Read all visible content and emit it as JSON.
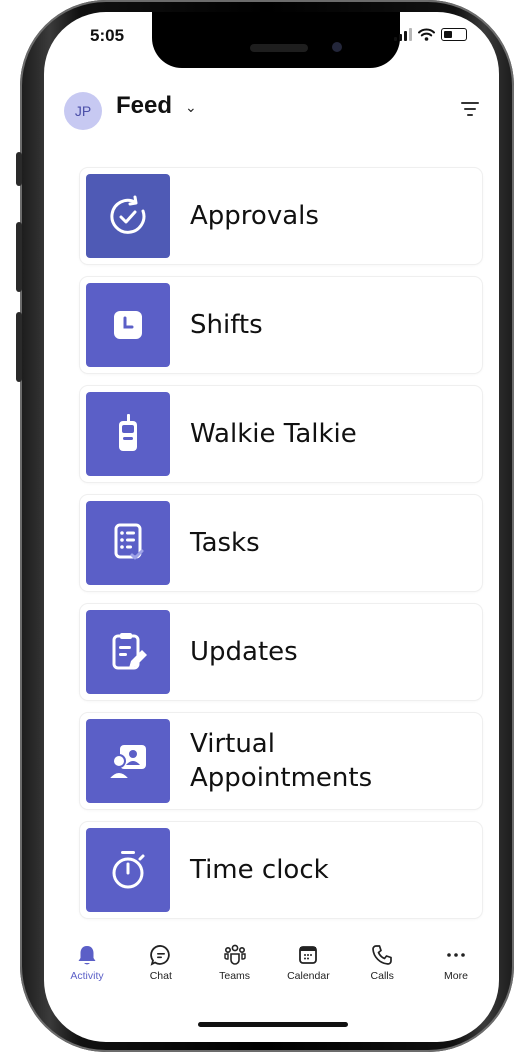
{
  "status_bar": {
    "time": "5:05"
  },
  "header": {
    "avatar_initials": "JP",
    "title": "Feed",
    "chevron": "⌄"
  },
  "apps": [
    {
      "label": "Approvals",
      "icon": "approvals-icon"
    },
    {
      "label": "Shifts",
      "icon": "clock-icon"
    },
    {
      "label": "Walkie Talkie",
      "icon": "walkie-talkie-icon"
    },
    {
      "label": "Tasks",
      "icon": "tasks-icon"
    },
    {
      "label": "Updates",
      "icon": "updates-icon"
    },
    {
      "label": "Virtual Appointments",
      "icon": "virtual-appointments-icon"
    },
    {
      "label": "Time clock",
      "icon": "timer-icon"
    }
  ],
  "tabbar": [
    {
      "label": "Activity",
      "icon": "bell-icon",
      "active": true
    },
    {
      "label": "Chat",
      "icon": "chat-icon"
    },
    {
      "label": "Teams",
      "icon": "teams-icon"
    },
    {
      "label": "Calendar",
      "icon": "calendar-icon"
    },
    {
      "label": "Calls",
      "icon": "phone-icon"
    },
    {
      "label": "More",
      "icon": "more-icon"
    }
  ],
  "colors": {
    "brand": "#5b5fc7",
    "avatar_bg": "#c7c9f2"
  }
}
